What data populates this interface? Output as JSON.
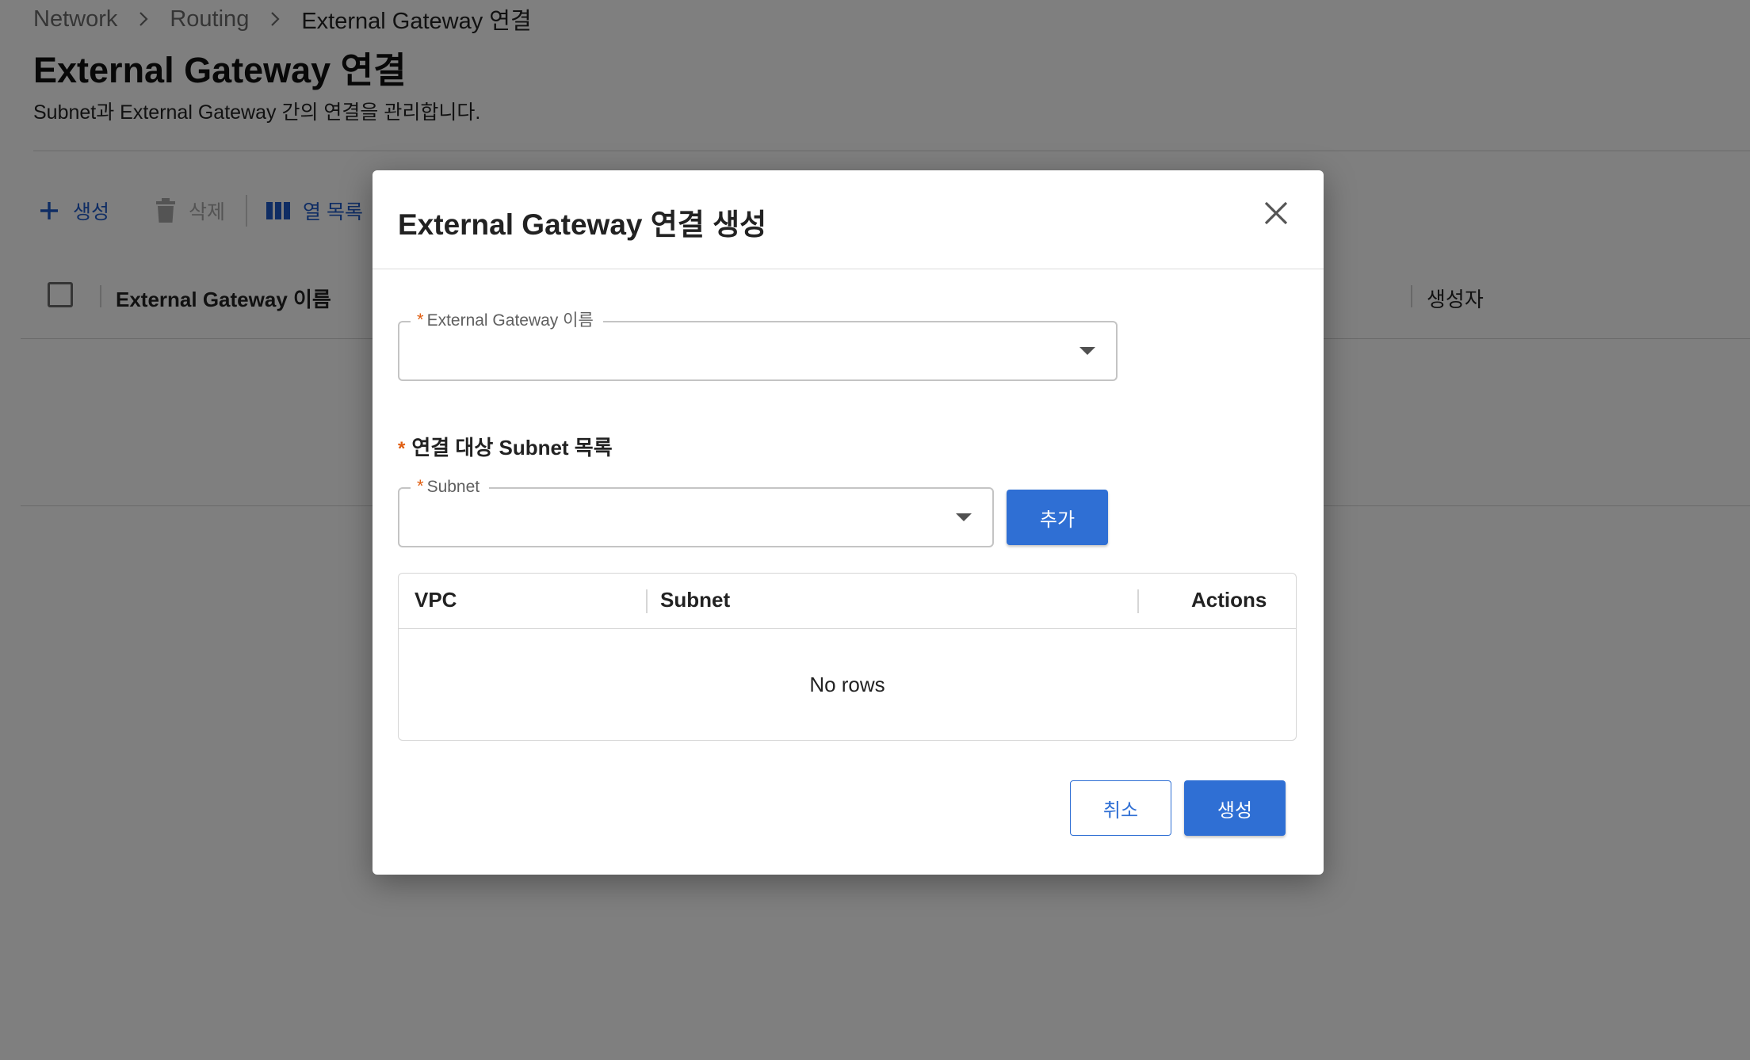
{
  "breadcrumb": {
    "items": [
      "Network",
      "Routing",
      "External Gateway 연결"
    ]
  },
  "page": {
    "title": "External Gateway 연결",
    "description": "Subnet과 External Gateway 간의 연결을 관리합니다."
  },
  "toolbar": {
    "create_label": "생성",
    "delete_label": "삭제",
    "columns_label": "열 목록"
  },
  "grid": {
    "columns": [
      "External Gateway 이름",
      "생성자"
    ]
  },
  "modal": {
    "title": "External Gateway 연결 생성",
    "gateway_field": {
      "label": "External Gateway 이름",
      "value": "",
      "required_mark": "*"
    },
    "subnet_section": {
      "label": "연결 대상 Subnet 목록",
      "required_mark": "*"
    },
    "subnet_field": {
      "label": "Subnet",
      "value": "",
      "required_mark": "*"
    },
    "add_button": "추가",
    "table": {
      "columns": [
        "VPC",
        "Subnet",
        "Actions"
      ],
      "empty_text": "No rows"
    },
    "cancel_button": "취소",
    "submit_button": "생성"
  },
  "colors": {
    "primary": "#2f6fd4",
    "link": "#1e5ac8",
    "required": "#e05d10",
    "overlay": "rgba(0,0,0,0.5)"
  },
  "icons": {
    "breadcrumb_separator": "chevron-right-icon",
    "create": "plus-icon",
    "delete": "trash-icon",
    "columns": "view-column-icon",
    "close": "close-icon",
    "dropdown": "caret-down-icon"
  }
}
